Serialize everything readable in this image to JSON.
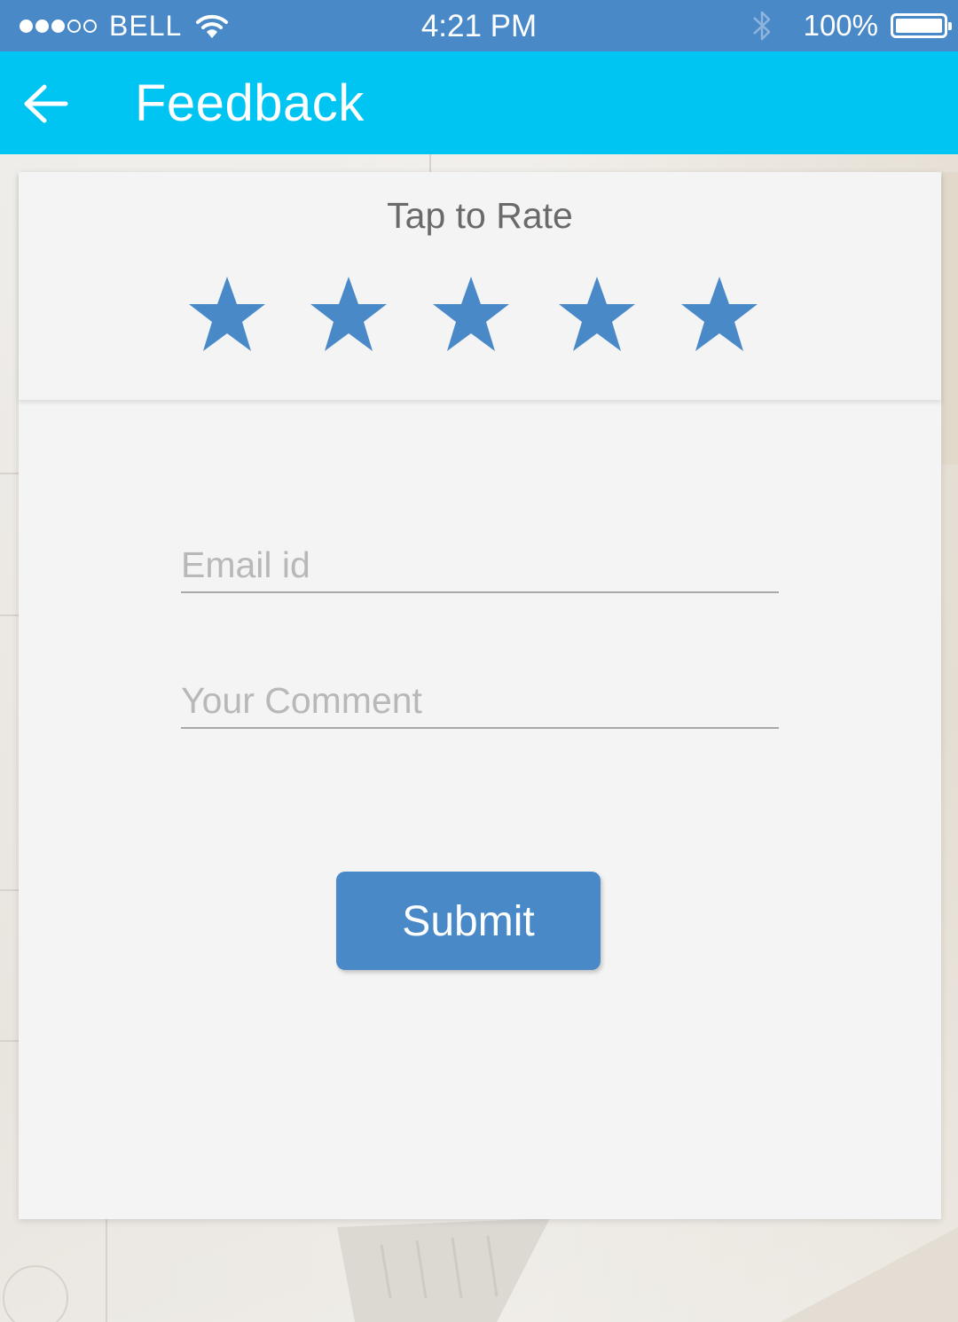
{
  "status_bar": {
    "carrier": "BELL",
    "signal_dots": [
      "full",
      "full",
      "full",
      "empty",
      "empty"
    ],
    "time": "4:21 PM",
    "battery_percent": "100%",
    "battery_level": 1.0
  },
  "app_bar": {
    "title": "Feedback",
    "back_icon": "arrow-left-icon"
  },
  "rating": {
    "title": "Tap to Rate",
    "stars": [
      1,
      2,
      3,
      4,
      5
    ],
    "star_color": "#4a89c8",
    "selected": 5
  },
  "form": {
    "email_placeholder": "Email id",
    "email_value": "",
    "comment_placeholder": "Your Comment",
    "comment_value": "",
    "submit_label": "Submit"
  },
  "colors": {
    "status_bar": "#4a89c8",
    "app_bar": "#00c4f1",
    "accent": "#4a89c8"
  }
}
